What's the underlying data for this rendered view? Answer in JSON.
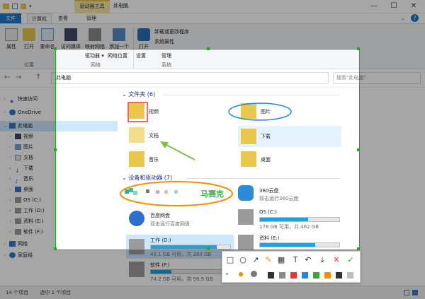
{
  "titlebar": {
    "title": "此电脑",
    "context_tab": "驱动器工具",
    "minimize": "—",
    "maximize": "☐",
    "close": "✕"
  },
  "tabs": {
    "file": "文件",
    "computer": "计算机",
    "view": "查看",
    "manage": "管理",
    "help": "?"
  },
  "ribbon": {
    "buttons": [
      {
        "label": "属性"
      },
      {
        "label": "打开"
      },
      {
        "label": "重命名"
      },
      {
        "label": "访问媒体"
      },
      {
        "label": "映射网络"
      },
      {
        "label": "添加一个"
      },
      {
        "label": "打开"
      }
    ],
    "map_drive_label": "驱动器 ▾",
    "network_location": "网络位置",
    "uninstall": "卸载或更改程序",
    "system_props": "系统属性",
    "settings": "设置",
    "manage": "管理",
    "group_location": "位置",
    "group_network": "网络",
    "group_system": "系统"
  },
  "nav": {
    "back": "←",
    "forward": "→",
    "up": "↑",
    "address": "此电脑",
    "search_placeholder": "搜索\"此电脑\""
  },
  "sidebar": {
    "quick_access": "快速访问",
    "onedrive": "OneDrive",
    "this_pc": "此电脑",
    "items": [
      "视频",
      "图片",
      "文档",
      "下载",
      "音乐",
      "桌面",
      "OS (C:)",
      "工作 (D:)",
      "资料 (E:)",
      "软件 (F:)"
    ],
    "network": "网络",
    "homegroup": "家庭组"
  },
  "main": {
    "folders_header": "文件夹 (6)",
    "folders": [
      "视频",
      "图片",
      "文档",
      "下载",
      "音乐",
      "桌面"
    ],
    "devices_header": "设备和驱动器 (7)",
    "cloud1": {
      "name": "360云盘",
      "sub": "双击运行360云盘"
    },
    "cloud2": {
      "name": "百度网盘",
      "sub": "双击运行百度网盘"
    },
    "drives": [
      {
        "name": "OS (C:)",
        "free": "178 GB 可用，共 462 GB",
        "used_pct": 61
      },
      {
        "name": "工作 (D:)",
        "free": "43.1 GB 可用，共 260 GB",
        "used_pct": 83
      },
      {
        "name": "资料 (E:)",
        "free": "",
        "used_pct": 70
      },
      {
        "name": "软件 (F:)",
        "free": "74.2 GB 可用，共 99.9 GB",
        "used_pct": 26
      }
    ]
  },
  "annotation": {
    "text": "马赛克"
  },
  "status": {
    "count": "14 个项目",
    "selected": "选中 1 个项目"
  },
  "screenshot_toolbar": {
    "tools": [
      "rect-tool",
      "ellipse-tool",
      "arrow-tool",
      "pen-tool",
      "mosaic-tool",
      "text-tool",
      "undo-tool",
      "save-tool",
      "cancel-tool",
      "confirm-tool"
    ],
    "colors": [
      "#333333",
      "#888888",
      "#e53935",
      "#1e88e5",
      "#43a047",
      "#fb8c00",
      "#333333",
      "#bdbdbd"
    ],
    "accent": "#1aad19"
  }
}
